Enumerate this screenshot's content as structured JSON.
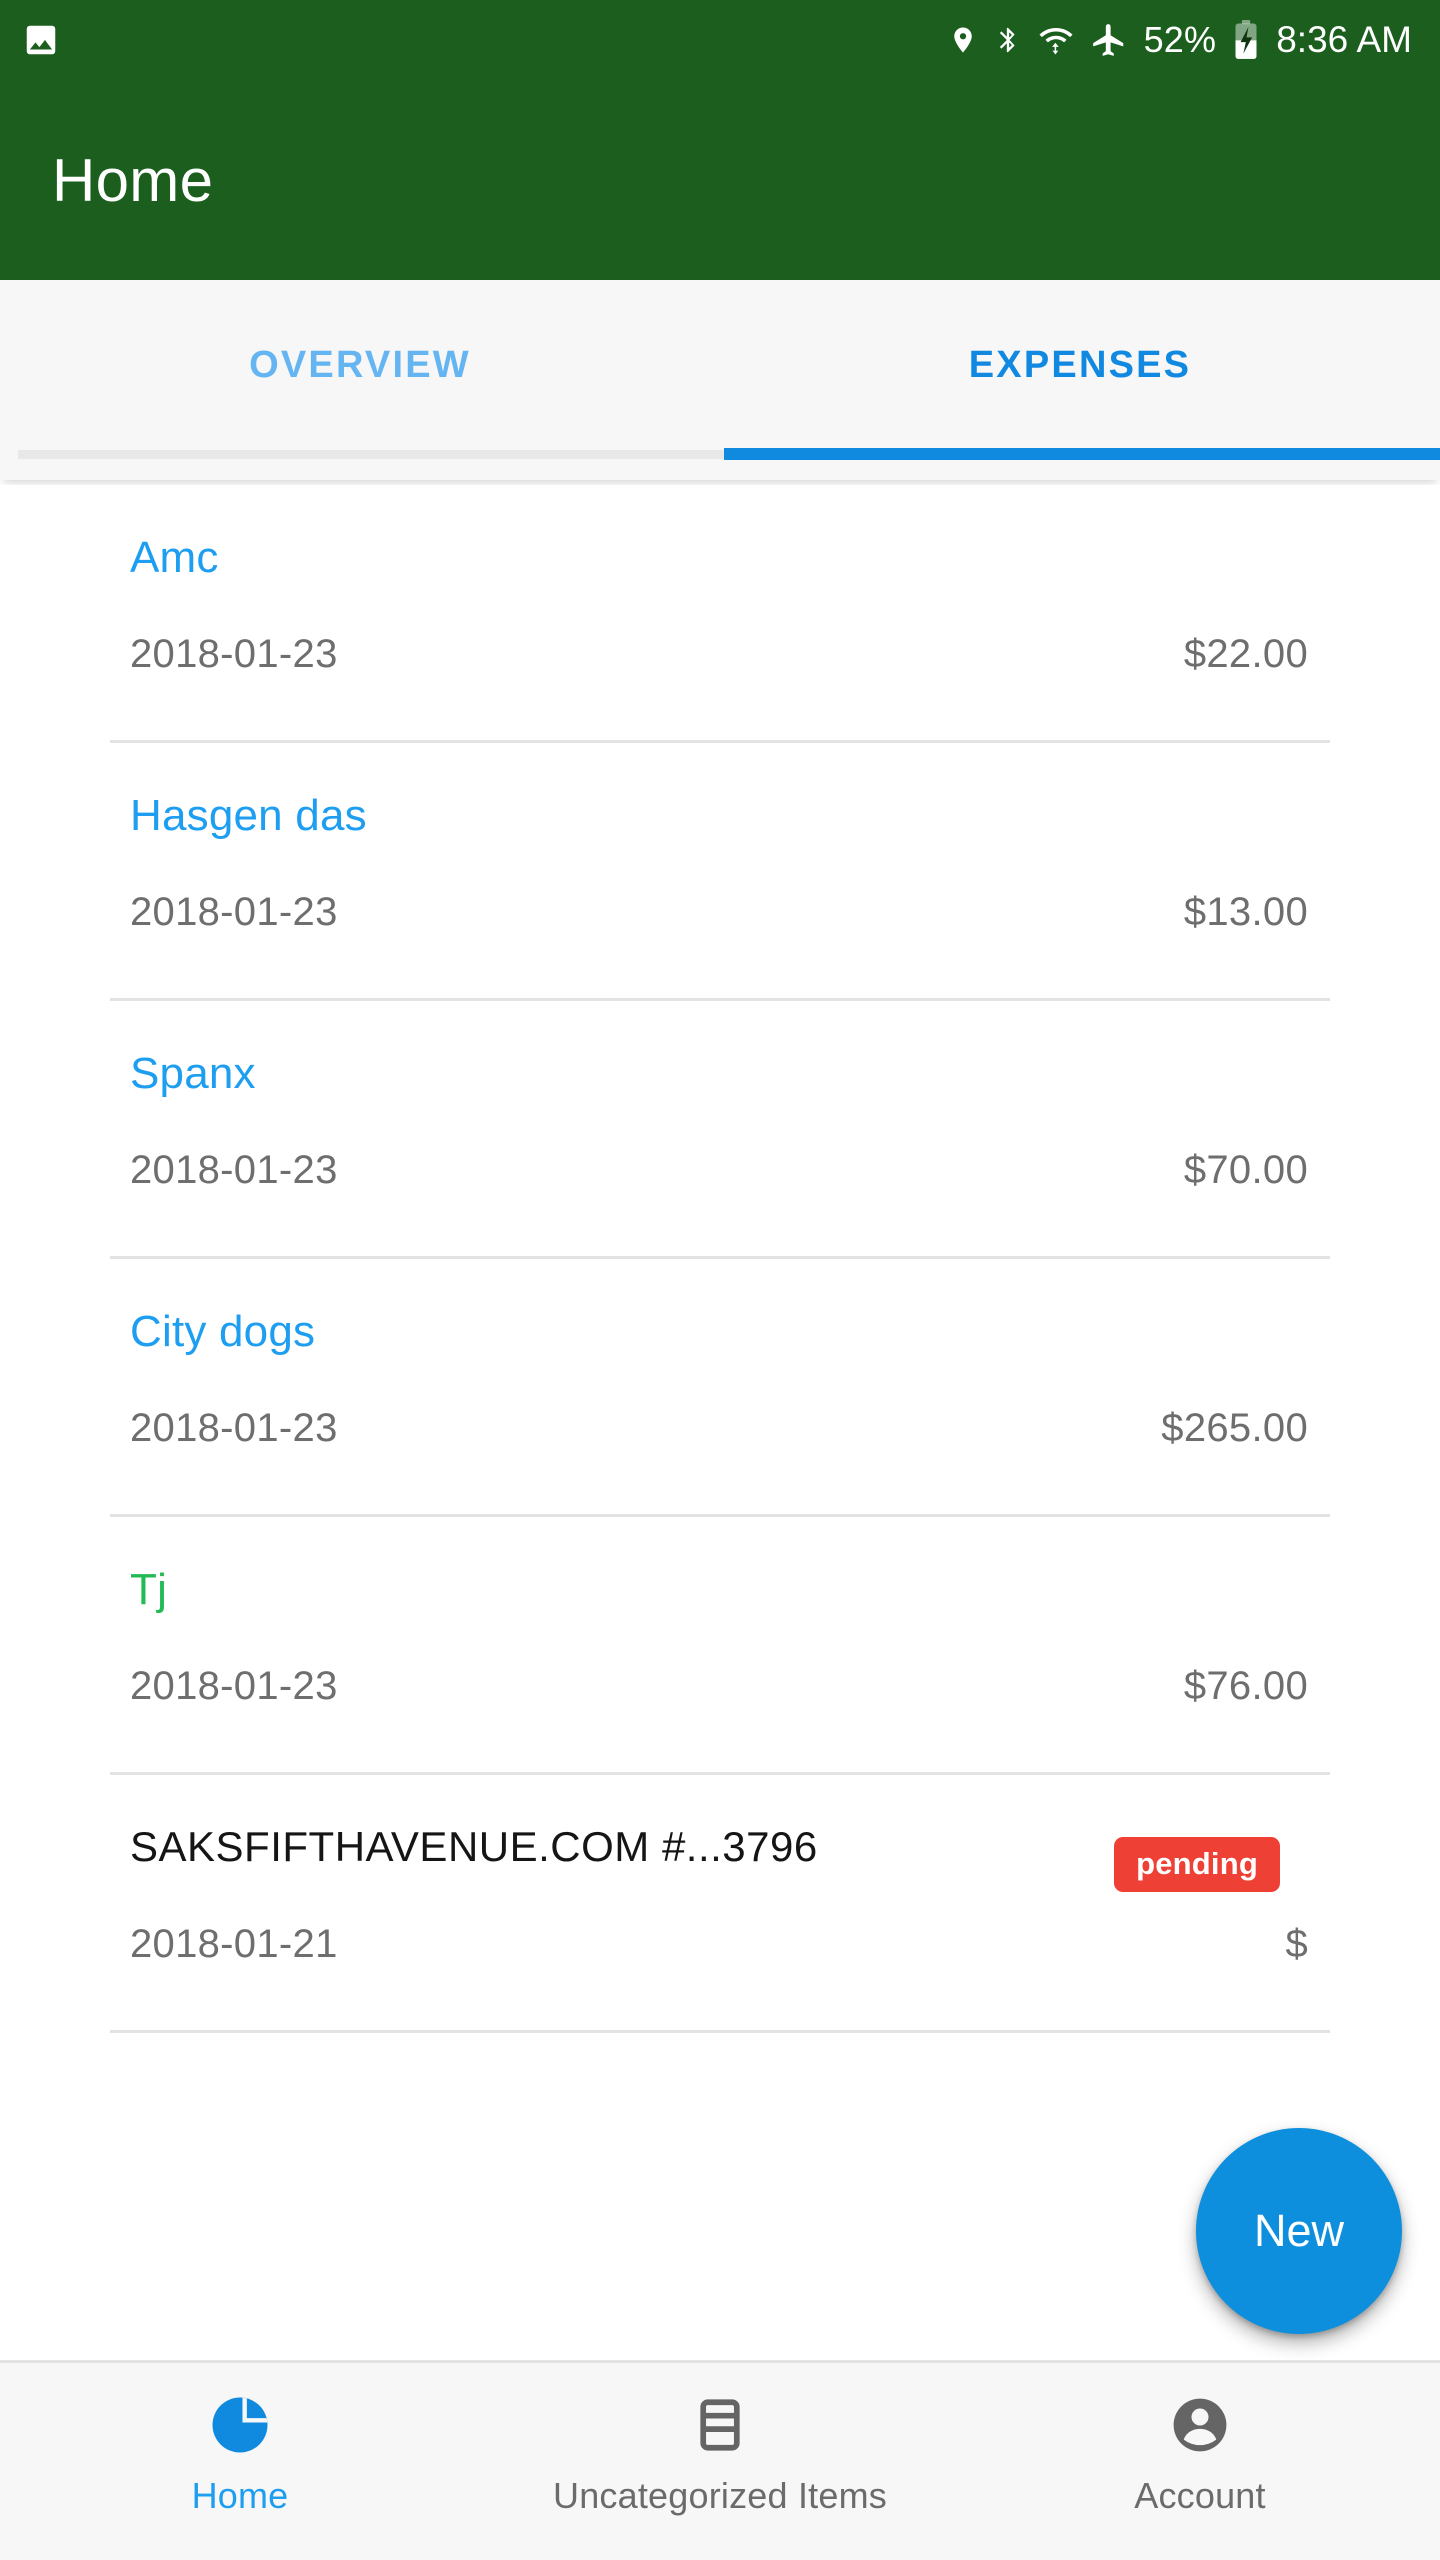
{
  "status_bar": {
    "notification_icon": "image-icon",
    "icons": [
      "location-pin-icon",
      "bluetooth-icon",
      "wifi-icon",
      "airplane-mode-icon"
    ],
    "battery_percent": "52%",
    "battery_icon": "battery-charging-icon",
    "time": "8:36 AM"
  },
  "app_bar": {
    "title": "Home"
  },
  "tabs": [
    {
      "label": "OVERVIEW",
      "active": false
    },
    {
      "label": "EXPENSES",
      "active": true
    }
  ],
  "expenses": [
    {
      "name": "Amc",
      "date": "2018-01-23",
      "amount": "$22.00",
      "color": "blue",
      "badge": null
    },
    {
      "name": "Hasgen das",
      "date": "2018-01-23",
      "amount": "$13.00",
      "color": "blue",
      "badge": null
    },
    {
      "name": "Spanx",
      "date": "2018-01-23",
      "amount": "$70.00",
      "color": "blue",
      "badge": null
    },
    {
      "name": "City dogs",
      "date": "2018-01-23",
      "amount": "$265.00",
      "color": "blue",
      "badge": null
    },
    {
      "name": "Tj",
      "date": "2018-01-23",
      "amount": "$76.00",
      "color": "green",
      "badge": null
    },
    {
      "name": "SAKSFIFTHAVENUE.COM #...3796",
      "date": "2018-01-21",
      "amount": "$",
      "color": "black",
      "badge": "pending"
    }
  ],
  "fab": {
    "label": "New"
  },
  "bottom_nav": [
    {
      "label": "Home",
      "icon": "pie-chart-icon",
      "active": true
    },
    {
      "label": "Uncategorized Items",
      "icon": "credit-card-icon",
      "active": false
    },
    {
      "label": "Account",
      "icon": "account-icon",
      "active": false
    }
  ],
  "colors": {
    "header_green": "#1b5e1e",
    "accent_blue": "#1e9ef0",
    "tab_active_blue": "#1289e0",
    "tab_inactive_blue": "#64b5f1",
    "green_item": "#22bb55",
    "badge_red": "#ef4036",
    "fab_blue": "#0e8fde"
  }
}
